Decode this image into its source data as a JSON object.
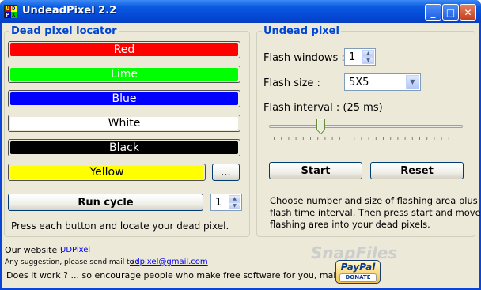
{
  "window": {
    "title": "UndeadPixel 2.2",
    "icon_letters": [
      "U",
      "D",
      "P",
      "X"
    ],
    "minimize_glyph": "_",
    "maximize_glyph": "□",
    "close_glyph": "✕"
  },
  "locator": {
    "title": "Dead pixel locator",
    "colors": [
      {
        "label": "Red",
        "fill": "#ff0000",
        "text_color": "#ffffff"
      },
      {
        "label": "Lime",
        "fill": "#00ff00",
        "text_color": "#ffffff"
      },
      {
        "label": "Blue",
        "fill": "#0000ff",
        "text_color": "#ffffff"
      },
      {
        "label": "White",
        "fill": "#ffffff",
        "text_color": "#000000"
      },
      {
        "label": "Black",
        "fill": "#000000",
        "text_color": "#ffffff"
      },
      {
        "label": "Yellow",
        "fill": "#ffff00",
        "text_color": "#000000"
      }
    ],
    "more_button_label": "...",
    "run_cycle_label": "Run cycle",
    "run_cycle_count": "1",
    "hint": "Press each button and locate your dead pixel."
  },
  "undead": {
    "title": "Undead pixel",
    "flash_windows_label": "Flash windows :",
    "flash_windows_value": "1",
    "flash_size_label": "Flash size :",
    "flash_size_value": "5X5",
    "flash_interval_label": "Flash interval : (25 ms)",
    "flash_interval_level": 0.25,
    "start_label": "Start",
    "reset_label": "Reset",
    "description": [
      "Choose number and size of flashing area plus",
      "flash time interval. Then press start and move",
      "flashing area into your dead pixels."
    ]
  },
  "footer": {
    "website_label": "Our website :",
    "website_value": "UDPixel",
    "suggestion_label": "Any suggestion, please send mail to :",
    "email": "udpixel@gmail.com",
    "donation_text": "Does it work ? ... so encourage people who make free software for you, make a gift :",
    "paypal_label": "PayPal",
    "donate_label": "DONATE",
    "watermark": "SnapFiles"
  },
  "colors": {
    "titlebar": "#0a5be0",
    "client_bg": "#ece9d8",
    "group_title": "#0046d5"
  }
}
